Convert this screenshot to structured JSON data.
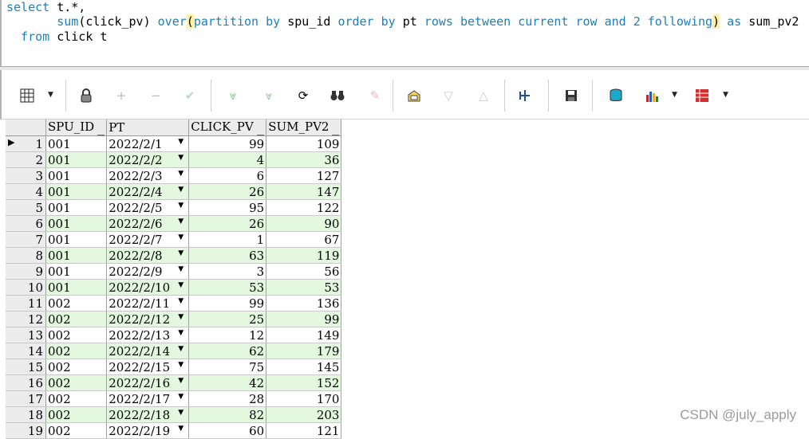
{
  "editor": {
    "line1_select": "select",
    "line1_rest": " t.*,",
    "line2_indent": "       ",
    "line2_sum": "sum",
    "line2_args": "(click_pv) ",
    "line2_over": "over",
    "line2_paren": "(",
    "line2_partition": "partition by",
    "line2_spu": " spu_id ",
    "line2_order": "order by",
    "line2_pt": " pt ",
    "line2_rows": "rows between current row and 2 following",
    "line2_close": ")",
    "line2_as": " as",
    "line2_alias": " sum_pv2",
    "line3_from": "  from",
    "line3_rest": " click t"
  },
  "grid": {
    "columns": [
      "SPU_ID",
      "PT",
      "CLICK_PV",
      "SUM_PV2"
    ],
    "rows": [
      {
        "n": "1",
        "spu": "001",
        "pt": "2022/2/1",
        "click": "99",
        "sum": "109"
      },
      {
        "n": "2",
        "spu": "001",
        "pt": "2022/2/2",
        "click": "4",
        "sum": "36"
      },
      {
        "n": "3",
        "spu": "001",
        "pt": "2022/2/3",
        "click": "6",
        "sum": "127"
      },
      {
        "n": "4",
        "spu": "001",
        "pt": "2022/2/4",
        "click": "26",
        "sum": "147"
      },
      {
        "n": "5",
        "spu": "001",
        "pt": "2022/2/5",
        "click": "95",
        "sum": "122"
      },
      {
        "n": "6",
        "spu": "001",
        "pt": "2022/2/6",
        "click": "26",
        "sum": "90"
      },
      {
        "n": "7",
        "spu": "001",
        "pt": "2022/2/7",
        "click": "1",
        "sum": "67"
      },
      {
        "n": "8",
        "spu": "001",
        "pt": "2022/2/8",
        "click": "63",
        "sum": "119"
      },
      {
        "n": "9",
        "spu": "001",
        "pt": "2022/2/9",
        "click": "3",
        "sum": "56"
      },
      {
        "n": "10",
        "spu": "001",
        "pt": "2022/2/10",
        "click": "53",
        "sum": "53"
      },
      {
        "n": "11",
        "spu": "002",
        "pt": "2022/2/11",
        "click": "99",
        "sum": "136"
      },
      {
        "n": "12",
        "spu": "002",
        "pt": "2022/2/12",
        "click": "25",
        "sum": "99"
      },
      {
        "n": "13",
        "spu": "002",
        "pt": "2022/2/13",
        "click": "12",
        "sum": "149"
      },
      {
        "n": "14",
        "spu": "002",
        "pt": "2022/2/14",
        "click": "62",
        "sum": "179"
      },
      {
        "n": "15",
        "spu": "002",
        "pt": "2022/2/15",
        "click": "75",
        "sum": "145"
      },
      {
        "n": "16",
        "spu": "002",
        "pt": "2022/2/16",
        "click": "42",
        "sum": "152"
      },
      {
        "n": "17",
        "spu": "002",
        "pt": "2022/2/17",
        "click": "28",
        "sum": "170"
      },
      {
        "n": "18",
        "spu": "002",
        "pt": "2022/2/18",
        "click": "82",
        "sum": "203"
      },
      {
        "n": "19",
        "spu": "002",
        "pt": "2022/2/19",
        "click": "60",
        "sum": "121"
      }
    ]
  },
  "watermark": "CSDN @july_apply",
  "colors": {
    "keyword": "#1f7fb4",
    "even_row": "#e4f8e0",
    "header_bg": "#ececec"
  }
}
